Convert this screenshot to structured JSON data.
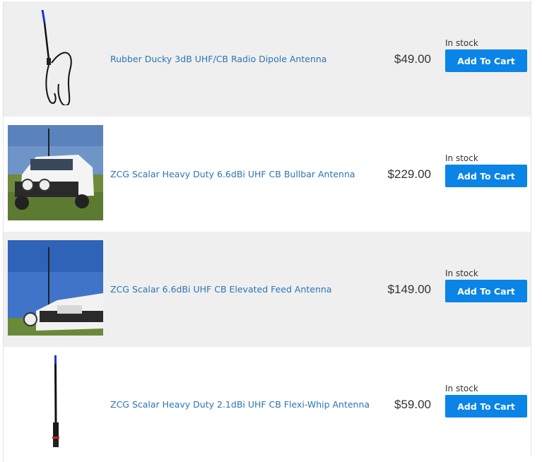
{
  "products": [
    {
      "name": "Rubber Ducky 3dB UHF/CB Radio Dipole Antenna",
      "price": "$49.00",
      "stock": "In stock",
      "button": "Add To Cart"
    },
    {
      "name": "ZCG Scalar Heavy Duty 6.6dBi UHF CB Bullbar Antenna",
      "price": "$229.00",
      "stock": "In stock",
      "button": "Add To Cart"
    },
    {
      "name": "ZCG Scalar 6.6dBi UHF CB Elevated Feed Antenna",
      "price": "$149.00",
      "stock": "In stock",
      "button": "Add To Cart"
    },
    {
      "name": "ZCG Scalar Heavy Duty 2.1dBi UHF CB Flexi-Whip Antenna",
      "price": "$59.00",
      "stock": "In stock",
      "button": "Add To Cart"
    }
  ],
  "colors": {
    "link": "#2c74b6",
    "button": "#0a84e6",
    "row_shade": "#efefef"
  }
}
